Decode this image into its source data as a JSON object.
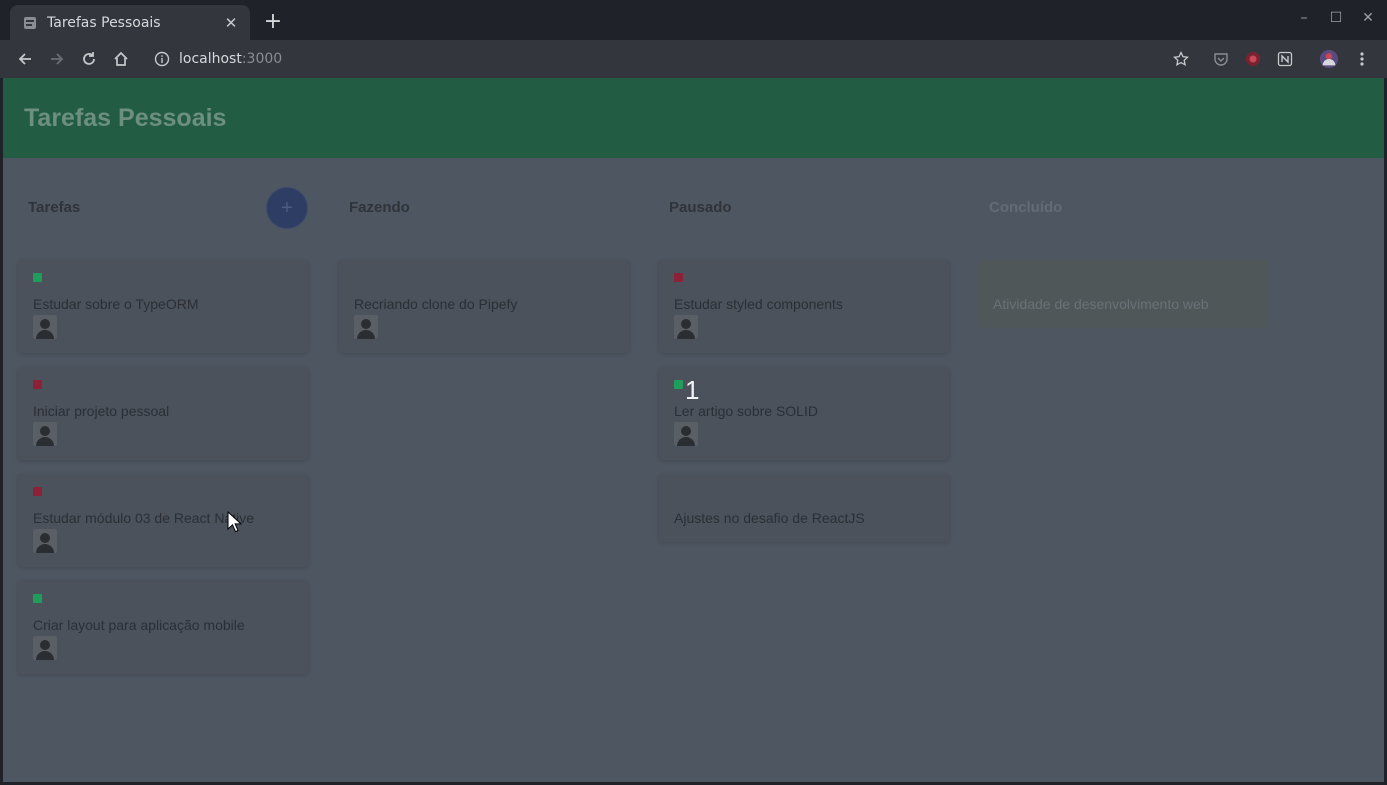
{
  "browser": {
    "tab_title": "Tarefas Pessoais",
    "tab_close": "✕",
    "new_tab": "+",
    "url_host": "localhost",
    "url_port": ":3000",
    "window_controls": [
      "–",
      "☐",
      "✕"
    ]
  },
  "app": {
    "title": "Tarefas Pessoais",
    "add_button": "+"
  },
  "columns": [
    {
      "title": "Tarefas",
      "cards": [
        {
          "title": "Estudar sobre o TypeORM",
          "label_color": "#1f9e5b",
          "avatar": true
        },
        {
          "title": "Iniciar projeto pessoal",
          "label_color": "#8c2137",
          "avatar": true
        },
        {
          "title": "Estudar módulo 03 de React Native",
          "label_color": "#8c2137",
          "avatar": true
        },
        {
          "title": "Criar layout para aplicação mobile",
          "label_color": "#1f9e5b",
          "avatar": true
        }
      ]
    },
    {
      "title": "Fazendo",
      "cards": [
        {
          "title": "Recriando clone do Pipefy",
          "label_color": "",
          "avatar": true
        }
      ]
    },
    {
      "title": "Pausado",
      "cards": [
        {
          "title": "Estudar styled components",
          "label_color": "#8c2137",
          "avatar": true
        },
        {
          "title": "Ler artigo sobre SOLID",
          "label_color": "#1f9e5b",
          "avatar": true
        },
        {
          "title": "Ajustes no desafio de ReactJS",
          "label_color": "",
          "avatar": false
        }
      ]
    },
    {
      "title": "Concluído",
      "cards": [
        {
          "title": "Atividade de desenvolvimento web",
          "label_color": "",
          "avatar": false
        }
      ]
    }
  ],
  "drag_indicator": "1"
}
